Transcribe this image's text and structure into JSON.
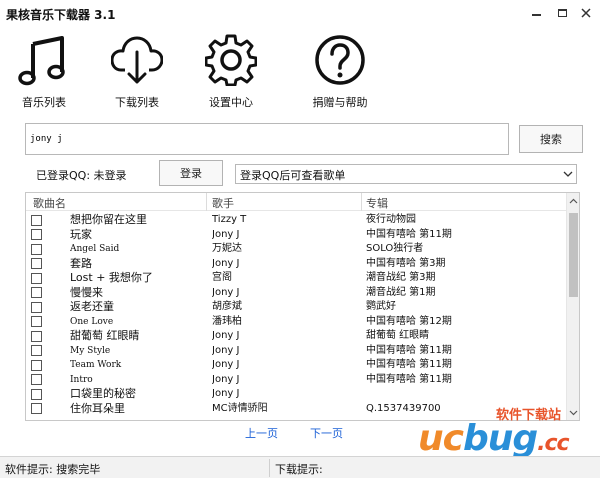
{
  "app": {
    "title": "果核音乐下载器 3.1"
  },
  "toolbar": [
    {
      "label": "音乐列表",
      "icon": "music-note-icon"
    },
    {
      "label": "下载列表",
      "icon": "cloud-download-icon"
    },
    {
      "label": "设置中心",
      "icon": "gear-icon"
    },
    {
      "label": "捐赠与帮助",
      "icon": "help-icon"
    }
  ],
  "search": {
    "value": "jony j",
    "button_label": "搜索"
  },
  "login": {
    "status_text": "已登录QQ: 未登录",
    "button_label": "登录",
    "playlist_select_value": "登录QQ后可查看歌单"
  },
  "table": {
    "columns": [
      "歌曲名",
      "歌手",
      "专辑"
    ],
    "rows": [
      {
        "song": "想把你留在这里",
        "artist": "Tizzy T",
        "album": "夜行动物园"
      },
      {
        "song": "玩家",
        "artist": "Jony J",
        "album": "中国有嘻哈 第11期"
      },
      {
        "song": "Angel Said",
        "artist": "万妮达",
        "album": "SOLO独行者"
      },
      {
        "song": "套路",
        "artist": "Jony J",
        "album": "中国有嘻哈 第3期"
      },
      {
        "song": "Lost + 我想你了",
        "artist": "宫阁",
        "album": "潮音战纪 第3期"
      },
      {
        "song": "慢慢来",
        "artist": "Jony J",
        "album": "潮音战纪 第1期"
      },
      {
        "song": "返老还童",
        "artist": "胡彦斌",
        "album": "鹦武好"
      },
      {
        "song": "One Love",
        "artist": "潘玮柏",
        "album": "中国有嘻哈 第12期"
      },
      {
        "song": "甜葡萄 红眼睛",
        "artist": "Jony J",
        "album": "甜葡萄 红眼睛"
      },
      {
        "song": "My Style",
        "artist": "Jony J",
        "album": "中国有嘻哈 第11期"
      },
      {
        "song": "Team Work",
        "artist": "Jony J",
        "album": "中国有嘻哈 第11期"
      },
      {
        "song": "Intro",
        "artist": "Jony J",
        "album": "中国有嘻哈 第11期"
      },
      {
        "song": "口袋里的秘密",
        "artist": "Jony J",
        "album": ""
      },
      {
        "song": "住你耳朵里",
        "artist": "MC诗情骄阳",
        "album": "Q.1537439700"
      }
    ]
  },
  "pager": {
    "prev_label": "上一页",
    "next_label": "下一页"
  },
  "statusbar": {
    "software_hint": "软件提示: 搜索完毕",
    "download_hint": "下载提示:"
  },
  "watermark": {
    "tagline": "软件下载站",
    "logo_uc": "uc",
    "logo_bug": "bug",
    "logo_cc": ".cc"
  },
  "colors": {
    "link": "#1a5fd6",
    "watermark_orange": "#f08a2a",
    "watermark_blue": "#2a8fd8",
    "watermark_red": "#e8542b"
  }
}
